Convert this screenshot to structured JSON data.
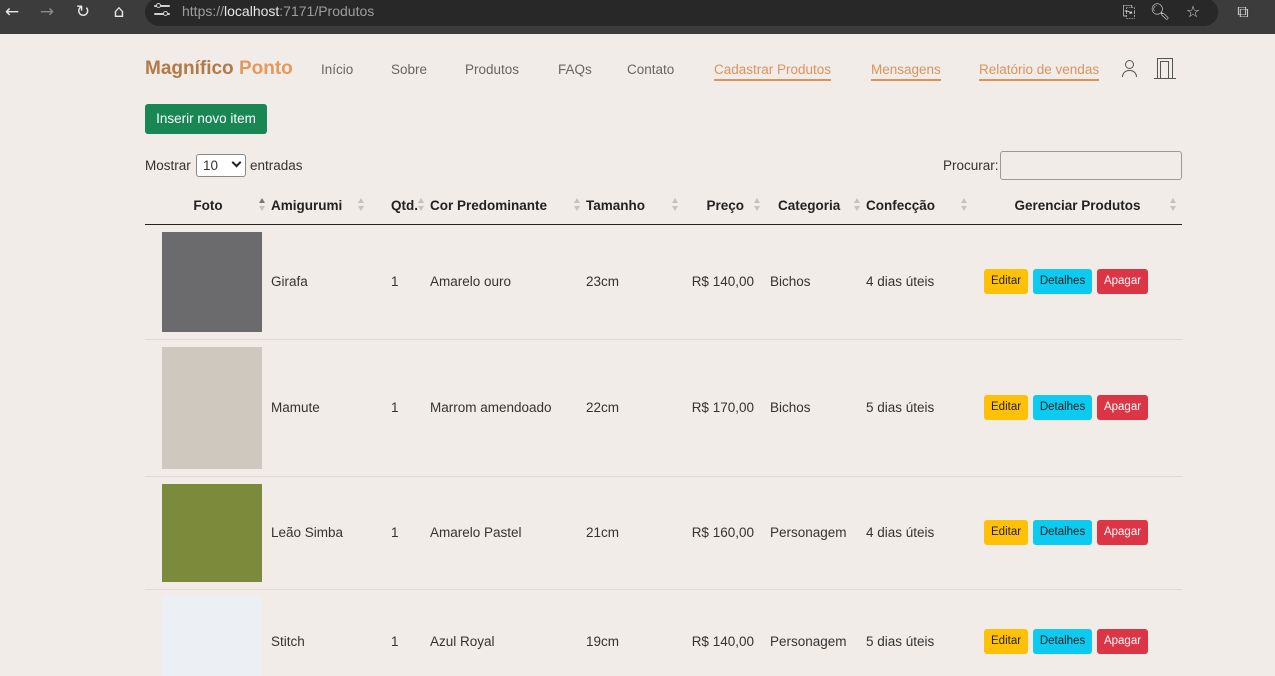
{
  "browser": {
    "url_prefix": "https://",
    "url_host": "localhost",
    "url_rest": ":7171/Produtos"
  },
  "header": {
    "brand_part1": "Magnífico",
    "brand_part2": "Ponto",
    "nav": [
      {
        "label": "Início",
        "active": false
      },
      {
        "label": "Sobre",
        "active": false
      },
      {
        "label": "Produtos",
        "active": false
      },
      {
        "label": "FAQs",
        "active": false
      },
      {
        "label": "Contato",
        "active": false
      },
      {
        "label": "Cadastrar Produtos",
        "active": true
      },
      {
        "label": "Mensagens",
        "active": true
      },
      {
        "label": "Relatório de vendas",
        "active": true
      }
    ]
  },
  "toolbar": {
    "insert_label": "Inserir novo item",
    "show_label": "Mostrar",
    "page_length": "10",
    "entries_label": "entradas",
    "search_label": "Procurar:",
    "search_value": ""
  },
  "table": {
    "columns": [
      "Foto",
      "Amigurumi",
      "Qtd.",
      "Cor Predominante",
      "Tamanho",
      "Preço",
      "Categoria",
      "Confecção",
      "Gerenciar Produtos"
    ],
    "rows": [
      {
        "name": "Girafa",
        "qty": "1",
        "color": "Amarelo ouro",
        "size": "23cm",
        "price": "R$ 140,00",
        "category": "Bichos",
        "time": "4 dias úteis",
        "photo_color": "#6b6b6d"
      },
      {
        "name": "Mamute",
        "qty": "1",
        "color": "Marrom amendoado",
        "size": "22cm",
        "price": "R$ 170,00",
        "category": "Bichos",
        "time": "5 dias úteis",
        "photo_color": "#cfc8bf"
      },
      {
        "name": "Leão Simba",
        "qty": "1",
        "color": "Amarelo Pastel",
        "size": "21cm",
        "price": "R$ 160,00",
        "category": "Personagem",
        "time": "4 dias úteis",
        "photo_color": "#7c8a3c"
      },
      {
        "name": "Stitch",
        "qty": "1",
        "color": "Azul Royal",
        "size": "19cm",
        "price": "R$ 140,00",
        "category": "Personagem",
        "time": "5 dias úteis",
        "photo_color": "#eceff4"
      }
    ],
    "actions": {
      "edit": "Editar",
      "details": "Detalhes",
      "delete": "Apagar"
    }
  },
  "colors": {
    "accent": "#d9935d",
    "brand": "#b37a48",
    "insert_button": "#198754",
    "edit": "#ffc107",
    "details": "#0dcaf0",
    "delete": "#dc3545"
  }
}
